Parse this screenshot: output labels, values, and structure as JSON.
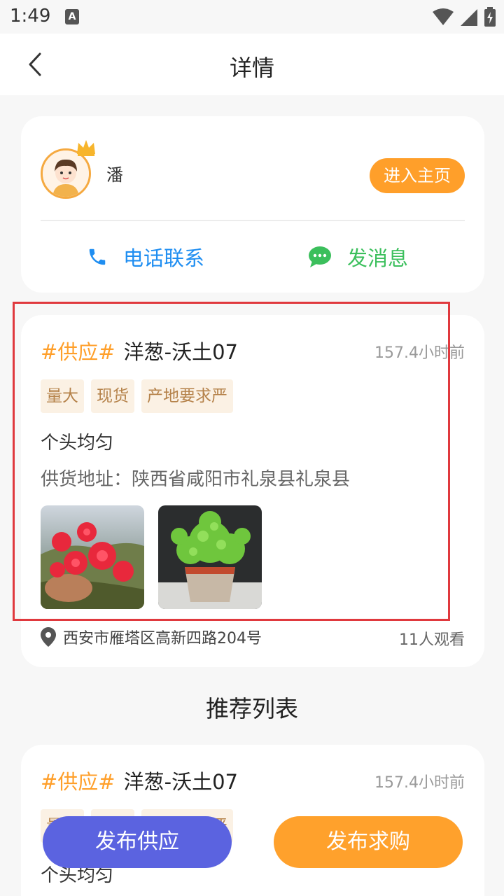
{
  "status_bar": {
    "time": "1:49",
    "a_icon": "A"
  },
  "header": {
    "title": "详情"
  },
  "user": {
    "name": "潘",
    "home_button": "进入主页",
    "phone_label": "电话联系",
    "message_label": "发消息"
  },
  "post": {
    "type_tag": "#供应#",
    "title": "洋葱-沃土07",
    "time": "157.4小时前",
    "tags": [
      "量大",
      "现货",
      "产地要求严"
    ],
    "description": "个头均匀",
    "address": "供货地址：陕西省咸阳市礼泉县礼泉县",
    "location": "西安市雁塔区高新四路204号",
    "views": "11人观看"
  },
  "recommend": {
    "section_title": "推荐列表",
    "items": [
      {
        "type_tag": "#供应#",
        "title": "洋葱-沃土07",
        "time": "157.4小时前",
        "tags": [
          "量大",
          "现货",
          "产地要求严"
        ],
        "description": "个头均匀"
      }
    ]
  },
  "actions": {
    "publish_supply": "发布供应",
    "publish_buy": "发布求购"
  },
  "colors": {
    "accent_orange": "#ff9f2a",
    "phone_blue": "#1f8ef1",
    "message_green": "#3bbf5c",
    "supply_purple": "#5b63e0",
    "highlight_red": "#e0393e"
  },
  "icons": [
    "back-arrow-icon",
    "phone-icon",
    "chat-bubble-icon",
    "location-pin-icon",
    "crown-icon",
    "wifi-icon",
    "signal-icon",
    "battery-icon"
  ]
}
